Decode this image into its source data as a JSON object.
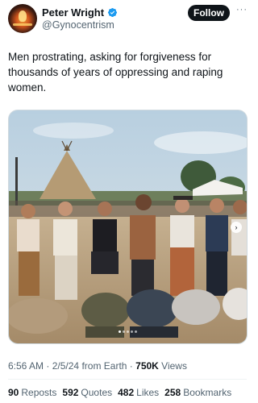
{
  "author": {
    "name": "Peter Wright",
    "handle": "@Gynocentrism",
    "verified": true
  },
  "follow_label": "Follow",
  "more_label": "···",
  "tweet": {
    "text": "Men prostrating, asking for forgiveness for thousands of years of oppressing and raping women."
  },
  "media": {
    "type": "photo",
    "carousel_dots": 5,
    "active_dot": 0,
    "next_arrow": "›"
  },
  "meta": {
    "time": "6:56 AM",
    "date": "2/5/24",
    "source": "from Earth",
    "views_count": "750K",
    "views_label": "Views",
    "separator": "·"
  },
  "stats": [
    {
      "count": "90",
      "label": "Reposts"
    },
    {
      "count": "592",
      "label": "Quotes"
    },
    {
      "count": "482",
      "label": "Likes"
    },
    {
      "count": "258",
      "label": "Bookmarks"
    }
  ],
  "colors": {
    "text": "#0f1419",
    "secondary": "#536471",
    "verified_blue": "#1d9bf0",
    "follow_bg": "#0f1419"
  }
}
